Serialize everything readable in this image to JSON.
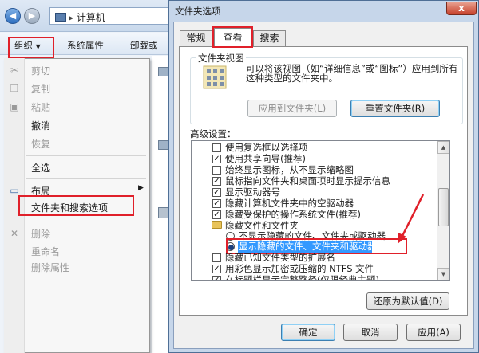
{
  "explorer": {
    "address": "计算机",
    "toolbar": {
      "organize": "组织",
      "system_properties": "系统属性",
      "uninstall": "卸载或"
    },
    "menu": [
      {
        "label": "剪切",
        "icon": "scissors-icon",
        "glyph": "✂",
        "disabled": true
      },
      {
        "label": "复制",
        "icon": "copy-icon",
        "glyph": "❐",
        "disabled": true
      },
      {
        "label": "粘贴",
        "icon": "paste-icon",
        "glyph": "▣",
        "disabled": true
      },
      {
        "label": "撤消",
        "icon": "",
        "glyph": "",
        "disabled": false
      },
      {
        "label": "恢复",
        "icon": "",
        "glyph": "",
        "disabled": true
      },
      {
        "label": "全选",
        "icon": "",
        "glyph": "",
        "disabled": false
      },
      {
        "label": "布局",
        "icon": "layout-icon",
        "glyph": "▭",
        "disabled": false
      },
      {
        "label": "文件夹和搜索选项",
        "icon": "",
        "glyph": "",
        "disabled": false
      },
      {
        "label": "删除",
        "icon": "delete-icon",
        "glyph": "✕",
        "disabled": true
      },
      {
        "label": "重命名",
        "icon": "",
        "glyph": "",
        "disabled": true
      },
      {
        "label": "删除属性",
        "icon": "",
        "glyph": "",
        "disabled": true
      }
    ]
  },
  "dialog": {
    "title": "文件夹选项",
    "close": "x",
    "tabs": {
      "general": "常规",
      "view": "查看",
      "search": "搜索"
    },
    "folder_view": {
      "title": "文件夹视图",
      "description": "可以将该视图（如“详细信息”或“图标”）应用到所有这种类型的文件夹中。",
      "apply_button": "应用到文件夹(L)",
      "reset_button": "重置文件夹(R)"
    },
    "advanced_label": "高级设置：",
    "settings": [
      {
        "type": "checkbox",
        "checked": false,
        "label": "使用复选框以选择项"
      },
      {
        "type": "checkbox",
        "checked": true,
        "label": "使用共享向导(推荐)"
      },
      {
        "type": "checkbox",
        "checked": false,
        "label": "始终显示图标，从不显示缩略图"
      },
      {
        "type": "checkbox",
        "checked": true,
        "label": "鼠标指向文件夹和桌面项时显示提示信息"
      },
      {
        "type": "checkbox",
        "checked": true,
        "label": "显示驱动器号"
      },
      {
        "type": "checkbox",
        "checked": true,
        "label": "隐藏计算机文件夹中的空驱动器"
      },
      {
        "type": "checkbox",
        "checked": true,
        "label": "隐藏受保护的操作系统文件(推荐)"
      },
      {
        "type": "folder",
        "checked": false,
        "label": "隐藏文件和文件夹"
      },
      {
        "type": "radio",
        "checked": false,
        "label": "不显示隐藏的文件、文件夹或驱动器"
      },
      {
        "type": "radio",
        "checked": true,
        "label": "显示隐藏的文件、文件夹和驱动器"
      },
      {
        "type": "checkbox",
        "checked": false,
        "label": "隐藏已知文件类型的扩展名"
      },
      {
        "type": "checkbox",
        "checked": true,
        "label": "用彩色显示加密或压缩的 NTFS 文件"
      },
      {
        "type": "checkbox",
        "checked": true,
        "label": "在标题栏显示完整路径(仅限经典主题)"
      }
    ],
    "restore_button": "还原为默认值(D)",
    "ok_button": "确定",
    "cancel_button": "取消",
    "apply_button": "应用(A)"
  }
}
